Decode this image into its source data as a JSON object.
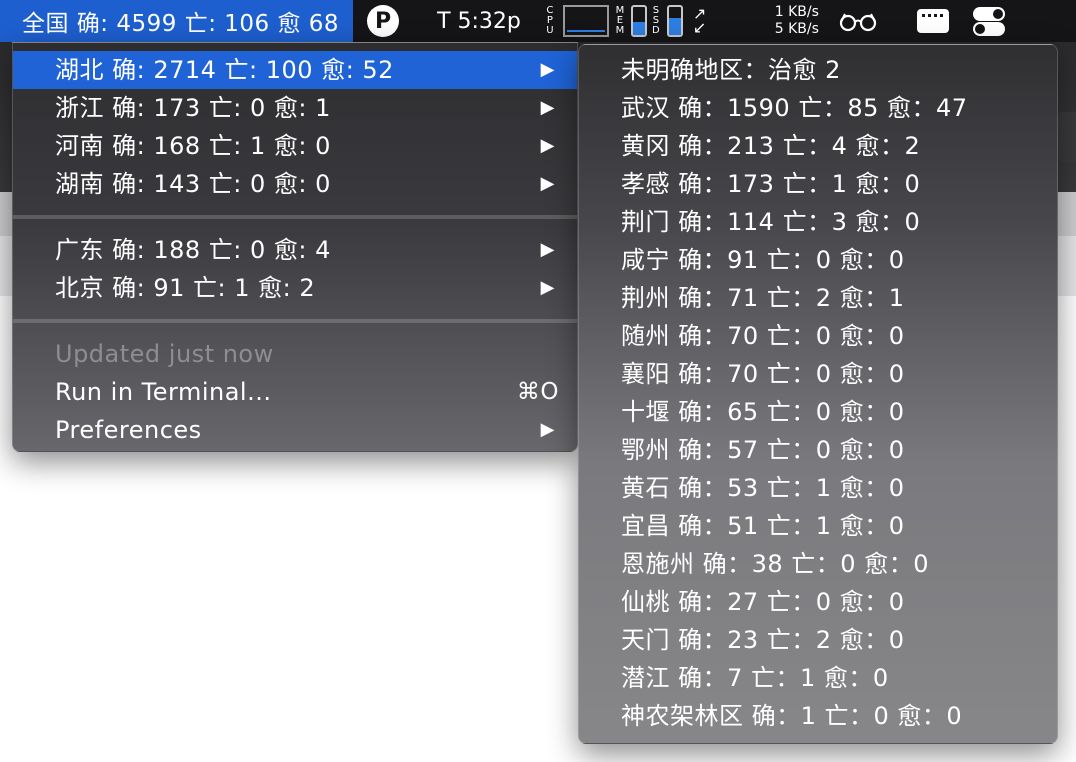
{
  "menubar": {
    "status_title": "全国 确: 4599 亡: 106 愈 68",
    "p_label": "P",
    "clock": "T 5:32p",
    "cpu_label": "CPU",
    "mem_label": "MEM",
    "ssd_label": "SSD",
    "mem_level": 0.45,
    "ssd_level": 0.6,
    "net_up": "1 KB/s",
    "net_down": "5 KB/s",
    "accent": "#1f63d6"
  },
  "main_menu": {
    "provinces_group1": [
      {
        "label": "湖北 确: 2714 亡: 100 愈: 52",
        "selected": true
      },
      {
        "label": "浙江 确: 173 亡: 0 愈: 1"
      },
      {
        "label": "河南 确: 168 亡: 1 愈: 0"
      },
      {
        "label": "湖南 确: 143 亡: 0 愈: 0"
      }
    ],
    "provinces_group2": [
      {
        "label": "广东 确: 188 亡: 0 愈: 4"
      },
      {
        "label": "北京 确: 91 亡: 1 愈: 2"
      }
    ],
    "updated": "Updated just now",
    "run_terminal": "Run in Terminal...",
    "run_shortcut": "⌘O",
    "preferences": "Preferences"
  },
  "submenu": {
    "items": [
      "未明确地区：治愈 2",
      "武汉 确：1590 亡：85 愈：47",
      "黄冈 确：213 亡：4 愈：2",
      "孝感 确：173 亡：1 愈：0",
      "荆门 确：114 亡：3 愈：0",
      "咸宁 确：91 亡：0 愈：0",
      "荆州 确：71 亡：2 愈：1",
      "随州 确：70 亡：0 愈：0",
      "襄阳 确：70 亡：0 愈：0",
      "十堰 确：65 亡：0 愈：0",
      "鄂州 确：57 亡：0 愈：0",
      "黄石 确：53 亡：1 愈：0",
      "宜昌 确：51 亡：1 愈：0",
      "恩施州 确：38 亡：0 愈：0",
      "仙桃 确：27 亡：0 愈：0",
      "天门 确：23 亡：2 愈：0",
      "潜江 确：7 亡：1 愈：0",
      "神农架林区 确：1 亡：0 愈：0"
    ]
  }
}
